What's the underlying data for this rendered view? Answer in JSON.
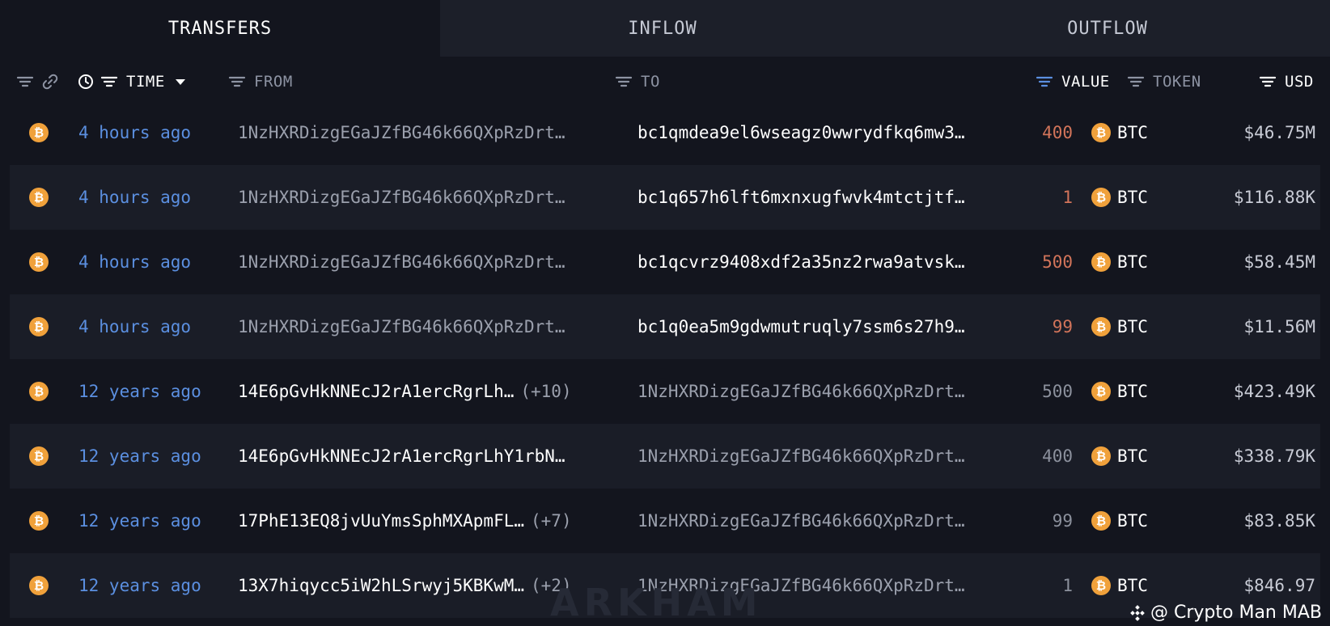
{
  "tabs": [
    "TRANSFERS",
    "INFLOW",
    "OUTFLOW"
  ],
  "header": {
    "time": "TIME",
    "from": "FROM",
    "to": "TO",
    "value": "VALUE",
    "token": "TOKEN",
    "usd": "USD"
  },
  "rows": [
    {
      "time": "4 hours ago",
      "from": "1NzHXRDizgEGaJZfBG46k66QXpRzDrt…",
      "from_more": "",
      "to": "bc1qmdea9el6wseagz0wwrydfkq6mw3…",
      "value": "400",
      "token": "BTC",
      "usd": "$46.75M"
    },
    {
      "time": "4 hours ago",
      "from": "1NzHXRDizgEGaJZfBG46k66QXpRzDrt…",
      "from_more": "",
      "to": "bc1q657h6lft6mxnxugfwvk4mtctjtf…",
      "value": "1",
      "token": "BTC",
      "usd": "$116.88K"
    },
    {
      "time": "4 hours ago",
      "from": "1NzHXRDizgEGaJZfBG46k66QXpRzDrt…",
      "from_more": "",
      "to": "bc1qcvrz9408xdf2a35nz2rwa9atvsk…",
      "value": "500",
      "token": "BTC",
      "usd": "$58.45M"
    },
    {
      "time": "4 hours ago",
      "from": "1NzHXRDizgEGaJZfBG46k66QXpRzDrt…",
      "from_more": "",
      "to": "bc1q0ea5m9gdwmutruqly7ssm6s27h9…",
      "value": "99",
      "token": "BTC",
      "usd": "$11.56M"
    },
    {
      "time": "12 years ago",
      "from": "14E6pGvHkNNEcJ2rA1ercRgrLh…",
      "from_more": "(+10)",
      "to": "1NzHXRDizgEGaJZfBG46k66QXpRzDrt…",
      "value": "500",
      "token": "BTC",
      "usd": "$423.49K"
    },
    {
      "time": "12 years ago",
      "from": "14E6pGvHkNNEcJ2rA1ercRgrLhY1rbN…",
      "from_more": "",
      "to": "1NzHXRDizgEGaJZfBG46k66QXpRzDrt…",
      "value": "400",
      "token": "BTC",
      "usd": "$338.79K"
    },
    {
      "time": "12 years ago",
      "from": "17PhE13EQ8jvUuYmsSphMXApmFL…",
      "from_more": "(+7)",
      "to": "1NzHXRDizgEGaJZfBG46k66QXpRzDrt…",
      "value": "99",
      "token": "BTC",
      "usd": "$83.85K"
    },
    {
      "time": "12 years ago",
      "from": "13X7hiqycc5iW2hLSrwyj5KBKwM…",
      "from_more": "(+2)",
      "to": "1NzHXRDizgEGaJZfBG46k66QXpRzDrt…",
      "value": "1",
      "token": "BTC",
      "usd": "$846.97"
    }
  ],
  "token_icon_symbol": "₿",
  "watermark_text": "@ Crypto Man MAB",
  "background_logo_text": "ARKHAM",
  "colors": {
    "time": "#5b8fe0",
    "value_out": "#d2745a",
    "value_in": "#8c919d",
    "btc": "#f0a13b"
  }
}
